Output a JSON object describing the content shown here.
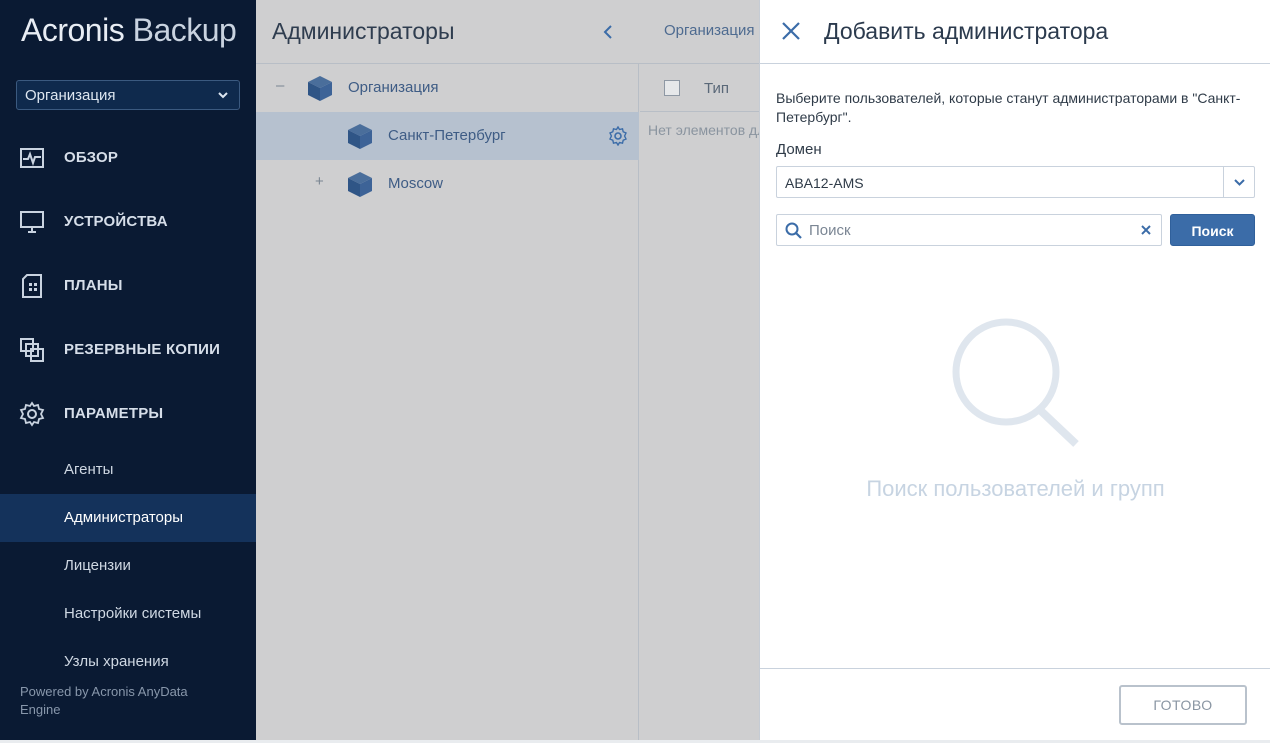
{
  "app": {
    "brand": "Acronis",
    "product": "Backup"
  },
  "sidebar": {
    "org_selector": "Организация",
    "nav": [
      {
        "label": "ОБЗОР",
        "icon": "dashboard-icon"
      },
      {
        "label": "УСТРОЙСТВА",
        "icon": "monitor-icon"
      },
      {
        "label": "ПЛАНЫ",
        "icon": "plan-icon"
      },
      {
        "label": "РЕЗЕРВНЫЕ КОПИИ",
        "icon": "backup-copies-icon"
      },
      {
        "label": "ПАРАМЕТРЫ",
        "icon": "gear-icon"
      }
    ],
    "subitems": [
      {
        "label": "Агенты",
        "active": false
      },
      {
        "label": "Администраторы",
        "active": true
      },
      {
        "label": "Лицензии",
        "active": false
      },
      {
        "label": "Настройки системы",
        "active": false
      },
      {
        "label": "Узлы хранения",
        "active": false
      }
    ],
    "powered_by": "Powered by Acronis AnyData Engine"
  },
  "main": {
    "title": "Администраторы",
    "tree": [
      {
        "label": "Организация",
        "expander": "–",
        "selected": false
      },
      {
        "label": "Санкт-Петербург",
        "expander": "",
        "selected": true
      },
      {
        "label": "Moscow",
        "expander": "+",
        "selected": false
      }
    ],
    "right": {
      "breadcrumb": "Организация",
      "column_type": "Тип",
      "empty_text": "Нет элементов для отображения"
    }
  },
  "dialog": {
    "title": "Добавить администратора",
    "description": "Выберите пользователей, которые станут администраторами в \"Санкт-Петербург\".",
    "domain_label": "Домен",
    "domain_value": "ABA12-AMS",
    "search_placeholder": "Поиск",
    "search_button": "Поиск",
    "empty_state": "Поиск пользователей и групп",
    "done_button": "ГОТОВО"
  },
  "colors": {
    "sidebar_bg": "#0a1a33",
    "sidebar_active": "#14325b",
    "accent": "#3b6ca8",
    "overlay": "#cfcfd0"
  }
}
